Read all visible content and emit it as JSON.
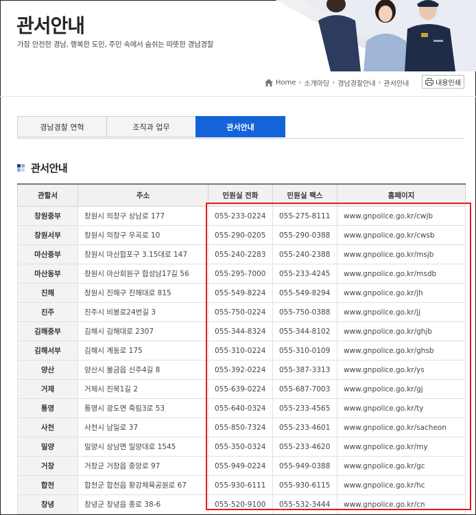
{
  "header": {
    "title": "관서안내",
    "subtitle": "가장 안전한 경남, 행복한 도민, 주민 속에서 숨쉬는 따뜻한 경남경찰"
  },
  "breadcrumb": [
    "Home",
    "소개마당",
    "경남경찰안내",
    "관서안내"
  ],
  "print_label": "내용인쇄",
  "tabs": [
    {
      "label": "경남경찰 연혁",
      "active": false
    },
    {
      "label": "조직과 업무",
      "active": false
    },
    {
      "label": "관서안내",
      "active": true
    }
  ],
  "section_title": "관서안내",
  "table": {
    "headers": [
      "관할서",
      "주소",
      "민원실 전화",
      "민원실 팩스",
      "홈페이지"
    ],
    "rows": [
      [
        "창원중부",
        "창원시 의창구 상남로 177",
        "055-233-0224",
        "055-275-8111",
        "www.gnpolice.go.kr/cwjb"
      ],
      [
        "창원서부",
        "창원시 의창구 우곡로 10",
        "055-290-0205",
        "055-290-0388",
        "www.gnpolice.go.kr/cwsb"
      ],
      [
        "마산중부",
        "창원시 마산합포구 3.15대로 147",
        "055-240-2283",
        "055-240-2388",
        "www.gnpolice.go.kr/msjb"
      ],
      [
        "마산동부",
        "창원시 마산회원구 합성남17길 56",
        "055-295-7000",
        "055-233-4245",
        "www.gnpolice.go.kr/msdb"
      ],
      [
        "진해",
        "창원시 진해구 진해대로 815",
        "055-549-8224",
        "055-549-8294",
        "www.gnpolice.go.kr/jh"
      ],
      [
        "진주",
        "진주시 비봉로24번길 3",
        "055-750-0224",
        "055-750-0388",
        "www.gnpolice.go.kr/jj"
      ],
      [
        "김해중부",
        "김해시 김해대로 2307",
        "055-344-8324",
        "055-344-8102",
        "www.gnpolice.go.kr/ghjb"
      ],
      [
        "김해서부",
        "김해시 계동로 175",
        "055-310-0224",
        "055-310-0109",
        "www.gnpolice.go.kr/ghsb"
      ],
      [
        "양산",
        "양산시 물금읍 신주4길 8",
        "055-392-0224",
        "055-387-3313",
        "www.gnpolice.go.kr/ys"
      ],
      [
        "거제",
        "거제시 진목1길 2",
        "055-639-0224",
        "055-687-7003",
        "www.gnpolice.go.kr/gj"
      ],
      [
        "통영",
        "통영시 광도면 죽림3로 53",
        "055-640-0324",
        "055-233-4565",
        "www.gnpolice.go.kr/ty"
      ],
      [
        "사천",
        "사천시 남일로 37",
        "055-850-7324",
        "055-233-4601",
        "www.gnpolice.go.kr/sacheon"
      ],
      [
        "밀양",
        "밀양시 상남면 밀양대로 1545",
        "055-350-0324",
        "055-233-4620",
        "www.gnpolice.go.kr/my"
      ],
      [
        "거창",
        "거창군 거창읍 중앙로 97",
        "055-949-0224",
        "055-949-0388",
        "www.gnpolice.go.kr/gc"
      ],
      [
        "합천",
        "합천군 합천읍 황강체육공원로 67",
        "055-930-6111",
        "055-930-6115",
        "www.gnpolice.go.kr/hc"
      ],
      [
        "창녕",
        "창녕군 창녕읍 종로 38-6",
        "055-520-9100",
        "055-532-3444",
        "www.gnpolice.go.kr/cn"
      ]
    ]
  },
  "colors": {
    "tab_active": "#1563d8",
    "highlight_border": "#e21a1a",
    "header_bg": "#f1f1f1"
  },
  "icons": [
    "home-icon",
    "print-icon",
    "section-square-icon"
  ]
}
